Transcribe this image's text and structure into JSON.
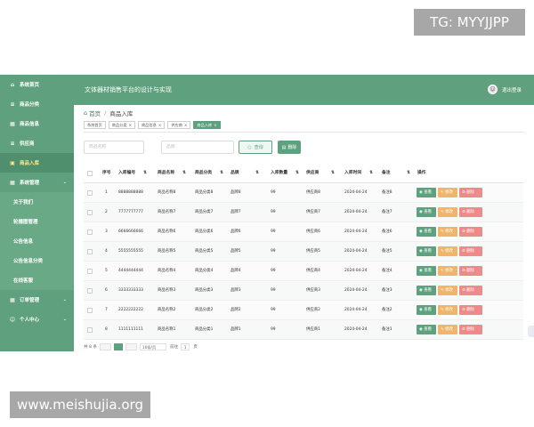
{
  "watermarks": {
    "top": "TG: MYYJJPP",
    "bottom": "www.meishujia.org"
  },
  "colors": {
    "primary": "#5fa07e",
    "view": "#5fa07e",
    "edit": "#f0b56a",
    "delete": "#ef8a8a"
  },
  "sidebar": {
    "items": [
      {
        "icon": "home-icon",
        "glyph": "⌂",
        "label": "系统首页"
      },
      {
        "icon": "list-icon",
        "glyph": "≡",
        "label": "商品分类"
      },
      {
        "icon": "grid-icon",
        "glyph": "▦",
        "label": "商品信息"
      },
      {
        "icon": "list-icon",
        "glyph": "≡",
        "label": "供应商"
      },
      {
        "icon": "box-icon",
        "glyph": "▣",
        "label": "商品入库"
      },
      {
        "icon": "grid-icon",
        "glyph": "▦",
        "label": "系统管理"
      }
    ],
    "sub_items": [
      "关于我们",
      "轮播图管理",
      "公告信息",
      "公告信息分类",
      "在线客服"
    ],
    "bottom_items": [
      {
        "icon": "grid-icon",
        "glyph": "▦",
        "label": "订单管理"
      },
      {
        "icon": "user-icon",
        "glyph": "☺",
        "label": "个人中心"
      }
    ]
  },
  "header": {
    "title": "文体器材销售平台的设计与实现",
    "logout": "退出登录"
  },
  "breadcrumb": {
    "home": "首页",
    "current": "商品入库"
  },
  "tags": [
    {
      "label": "系统首页",
      "closable": false,
      "active": false
    },
    {
      "label": "商品分类",
      "closable": true,
      "active": false
    },
    {
      "label": "商品信息",
      "closable": true,
      "active": false
    },
    {
      "label": "供应商",
      "closable": true,
      "active": false
    },
    {
      "label": "商品入库",
      "closable": true,
      "active": true
    }
  ],
  "toolbar": {
    "search1_placeholder": "商品名称",
    "search2_placeholder": "品牌",
    "search_label": "查询",
    "delete_label": "删除"
  },
  "table": {
    "headers": [
      "序号",
      "入库编号",
      "商品名称",
      "商品分类",
      "品牌",
      "入库数量",
      "供应商",
      "入库时间",
      "备注",
      "操作"
    ],
    "rows": [
      [
        "1",
        "8888888888",
        "商品名称8",
        "商品分类8",
        "品牌8",
        "99",
        "供应商8",
        "2024-04-24",
        "备注8"
      ],
      [
        "2",
        "7777777777",
        "商品名称7",
        "商品分类7",
        "品牌7",
        "99",
        "供应商7",
        "2024-04-24",
        "备注7"
      ],
      [
        "3",
        "6666666666",
        "商品名称6",
        "商品分类6",
        "品牌6",
        "99",
        "供应商6",
        "2024-04-24",
        "备注6"
      ],
      [
        "4",
        "5555555555",
        "商品名称5",
        "商品分类5",
        "品牌5",
        "99",
        "供应商5",
        "2024-04-24",
        "备注5"
      ],
      [
        "5",
        "4444444444",
        "商品名称4",
        "商品分类4",
        "品牌4",
        "99",
        "供应商4",
        "2024-04-24",
        "备注4"
      ],
      [
        "6",
        "3333333333",
        "商品名称3",
        "商品分类3",
        "品牌3",
        "99",
        "供应商3",
        "2024-04-24",
        "备注3"
      ],
      [
        "7",
        "2222222222",
        "商品名称2",
        "商品分类2",
        "品牌2",
        "99",
        "供应商2",
        "2024-04-24",
        "备注2"
      ],
      [
        "8",
        "1111111111",
        "商品名称1",
        "商品分类1",
        "品牌1",
        "99",
        "供应商1",
        "2024-04-24",
        "备注1"
      ]
    ],
    "actions": {
      "view": "查看",
      "edit": "修改",
      "delete": "删除"
    }
  },
  "pagination": {
    "total": "共 8 条",
    "page_size": "10条/页",
    "goto": "前往",
    "page": "1",
    "unit": "页"
  }
}
